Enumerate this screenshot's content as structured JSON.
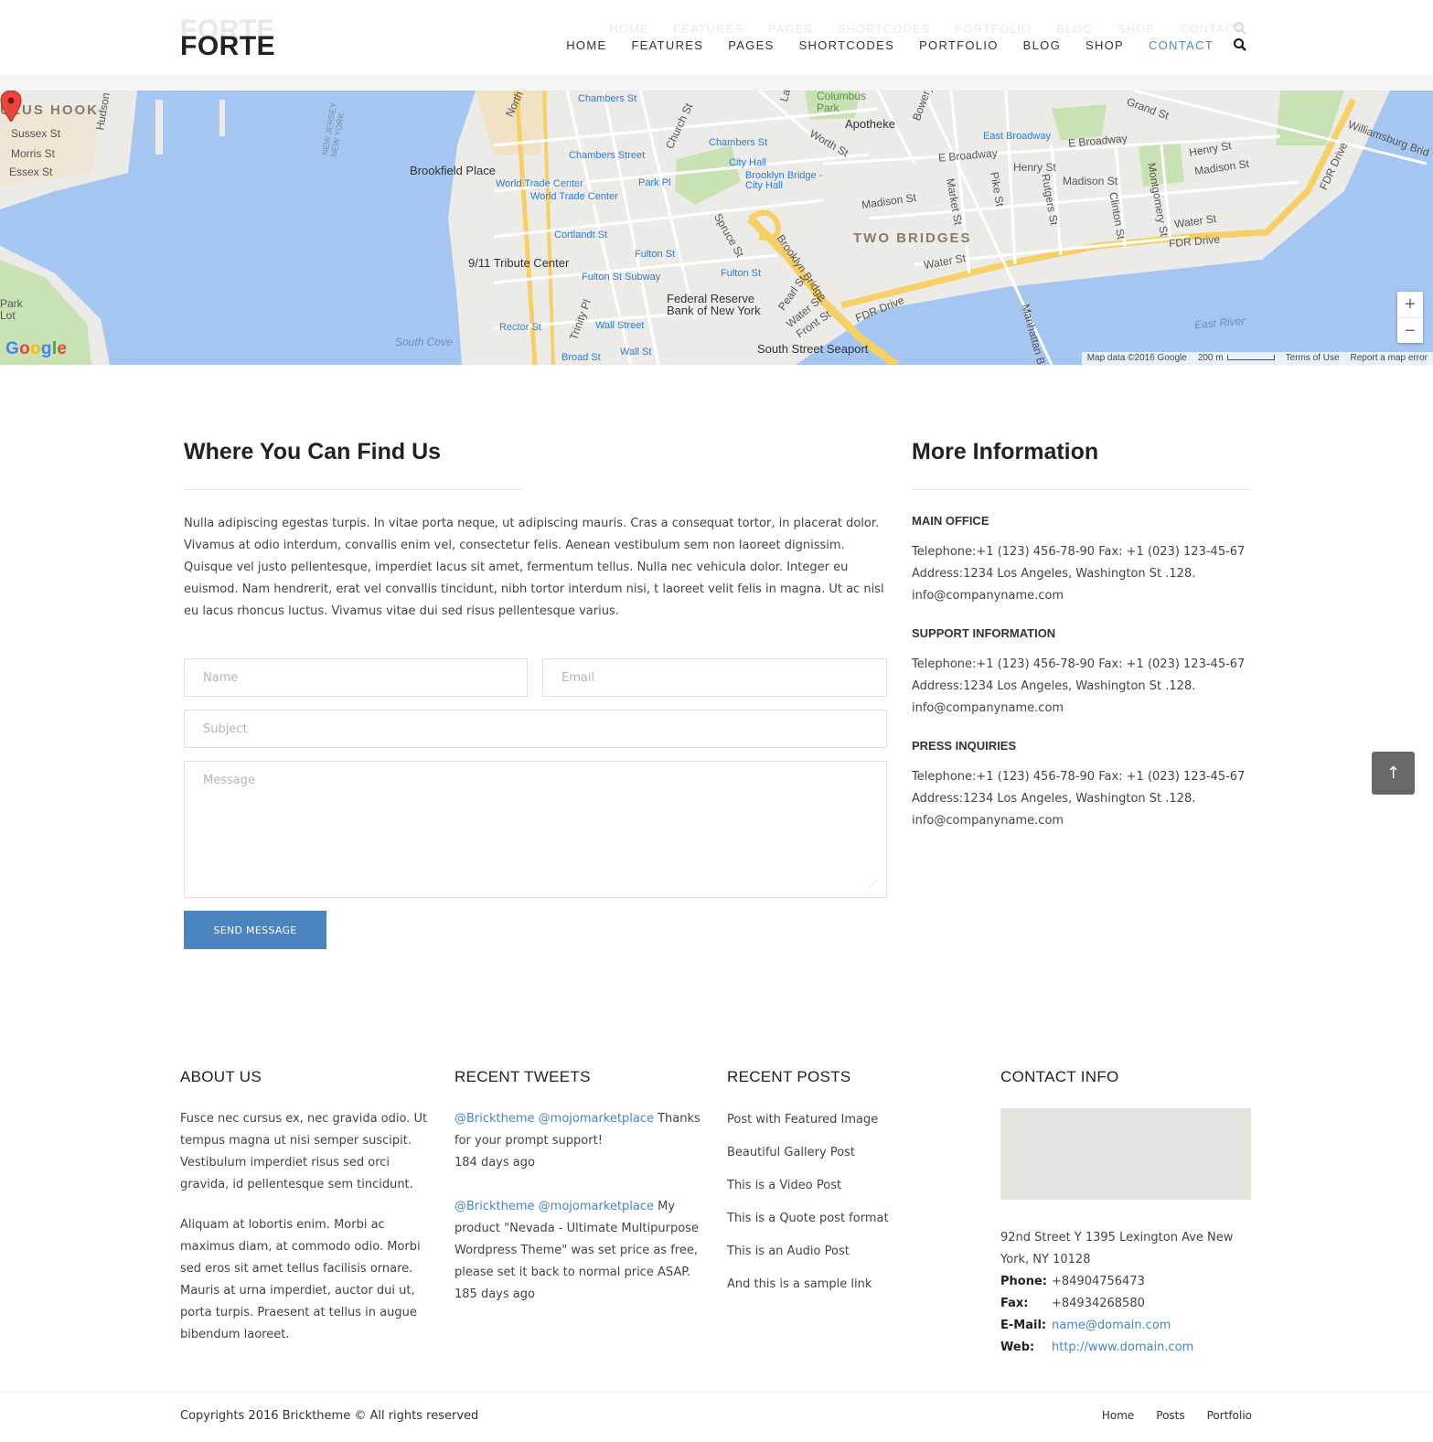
{
  "header": {
    "logo": "FORTE",
    "nav": [
      "HOME",
      "FEATURES",
      "PAGES",
      "SHORTCODES",
      "PORTFOLIO",
      "BLOG",
      "SHOP",
      "CONTACT"
    ],
    "active_nav": "CONTACT",
    "search_icon": "search-icon"
  },
  "map": {
    "labels": {
      "paulus_hook": "ULUS HOOK",
      "sussex": "Sussex St",
      "morris": "Morris St",
      "essex": "Essex St",
      "hudson": "Hudson St",
      "park_lot": "Park Lot",
      "nj_ny": "NEW JERSEY NEW YORK",
      "brookfield": "Brookfield Place",
      "wtc1": "World Trade Center",
      "wtc2": "World Trade Center",
      "chambers1": "Chambers St",
      "chambers2": "Chambers Street",
      "chambers3": "Chambers St",
      "church": "Church St",
      "north_end": "North",
      "city_hall": "City Hall",
      "park_pl": "Park Pl",
      "bb_city_hall": "Brooklyn Bridge - City Hall",
      "columbus_park": "Columbus Park",
      "apotheke": "Apotheke",
      "worth": "Worth St",
      "bowery": "Bowery",
      "lafayette": "La",
      "grand": "Grand St",
      "east_broadway_station": "East Broadway",
      "e_broadway": "E Broadway",
      "e_broadway2": "E Broadway",
      "henry": "Henry St",
      "henry2": "Henry St",
      "madison": "Madison St",
      "madison2": "Madison St",
      "madison3": "Madison St",
      "williamsburg": "Williamsburg Brid",
      "fdr1": "FDR Drive",
      "fdr2": "FDR Drive",
      "fdr3": "FDR Drive",
      "two_bridges": "TWO BRIDGES",
      "market": "Market St",
      "pike": "Pike St",
      "rutgers": "Rutgers St",
      "clinton": "Clinton St",
      "montgomery": "Montgomery St",
      "water": "Water St",
      "water2": "Water St",
      "water3": "Water St",
      "cortlandt": "Cortlandt St",
      "fulton": "Fulton St",
      "fulton2": "Fulton St",
      "fulton_subway": "Fulton St Subway",
      "tribute": "9/11 Tribute Center",
      "federal_reserve": "Federal Reserve Bank of New York",
      "spruce": "Spruce St",
      "brooklyn_bridge": "Brooklyn Bridge",
      "pearl": "Pearl St",
      "front": "Front St",
      "trinity": "Trinity Pl",
      "rector": "Rector St",
      "wall": "Wall Street",
      "wall2": "Wall St",
      "broad": "Broad St",
      "south_cove": "South Cove",
      "seaport": "South Street Seaport",
      "east_river": "East River",
      "manhattan_br": "Manhattan Br"
    },
    "google": "Google",
    "attribution": [
      "Map data ©2016 Google",
      "200 m",
      "Terms of Use",
      "Report a map error"
    ],
    "zoom_in": "+",
    "zoom_out": "−"
  },
  "find_us": {
    "title": "Where You Can Find Us",
    "text": "Nulla adipiscing egestas turpis. In vitae porta neque, ut adipiscing mauris. Cras a consequat tortor, in placerat dolor. Vivamus at odio interdum, convallis enim vel, consectetur felis. Aenean vestibulum sem non laoreet dignissim. Quisque vel justo pellentesque, imperdiet lacus sit amet, fermentum tellus. Nulla nec vehicula dolor. Integer eu euismod. Nam hendrerit, erat vel convallis tincidunt, nibh tortor interdum nisi, t laoreet velit felis in magna. Ut ac nisl eu lacus rhoncus luctus. Vivamus vitae dui sed risus pellentesque varius."
  },
  "form": {
    "name_placeholder": "Name",
    "email_placeholder": "Email",
    "subject_placeholder": "Subject",
    "message_placeholder": "Message",
    "submit": "SEND MESSAGE"
  },
  "more_info": {
    "title": "More Information",
    "sections": [
      {
        "title": "MAIN OFFICE",
        "phone": "Telephone:+1 (123) 456-78-90 Fax: +1 (023) 123-45-67",
        "address": "Address:1234 Los Angeles, Washington St .128.",
        "email": "info@companyname.com"
      },
      {
        "title": "SUPPORT INFORMATION",
        "phone": "Telephone:+1 (123) 456-78-90 Fax: +1 (023) 123-45-67",
        "address": "Address:1234 Los Angeles, Washington St .128.",
        "email": "info@companyname.com"
      },
      {
        "title": "PRESS INQUIRIES",
        "phone": "Telephone:+1 (123) 456-78-90 Fax: +1 (023) 123-45-67",
        "address": "Address:1234 Los Angeles, Washington St .128.",
        "email": "info@companyname.com"
      }
    ]
  },
  "scroll_top": "↑",
  "footer": {
    "about": {
      "title": "ABOUT US",
      "p1": "Fusce nec cursus ex, nec gravida odio. Ut tempus magna ut nisi semper suscipit. Vestibulum imperdiet risus sed orci gravida, id pellentesque sem tincidunt.",
      "p2": "Aliquam at lobortis enim. Morbi ac maximus diam, at commodo odio. Morbi sed eros sit amet tellus facilisis ornare. Mauris at urna imperdiet, auctor dui ut, porta turpis. Praesent at tellus in augue bibendum laoreet."
    },
    "tweets": {
      "title": "RECENT TWEETS",
      "items": [
        {
          "links": "@Bricktheme @mojomarketplace",
          "text": " Thanks for your prompt support!",
          "time": "184 days ago"
        },
        {
          "links": "@Bricktheme @mojomarketplace",
          "text": " My product \"Nevada - Ultimate Multipurpose Wordpress Theme\" was set price as free, please set it back to normal price ASAP.",
          "time": "185 days ago"
        }
      ]
    },
    "posts": {
      "title": "RECENT POSTS",
      "items": [
        "Post with Featured Image",
        "Beautiful Gallery Post",
        "This is a Video Post",
        "This is a Quote post format",
        "This is an Audio Post",
        "And this is a sample link"
      ]
    },
    "contact": {
      "title": "CONTACT INFO",
      "address": "92nd Street Y 1395 Lexington Ave New York, NY 10128",
      "phone_label": "Phone:",
      "phone": "+84904756473",
      "fax_label": "Fax:",
      "fax": "+84934268580",
      "email_label": "E-Mail:",
      "email": "name@domain.com",
      "web_label": "Web:",
      "web": "http://www.domain.com"
    },
    "copyright": "Copyrights 2016 Bricktheme © All rights reserved",
    "links": [
      "Home",
      "Posts",
      "Portfolio"
    ]
  },
  "colors": {
    "accent": "#4a84c1",
    "dark": "#222222",
    "text": "#444444"
  }
}
